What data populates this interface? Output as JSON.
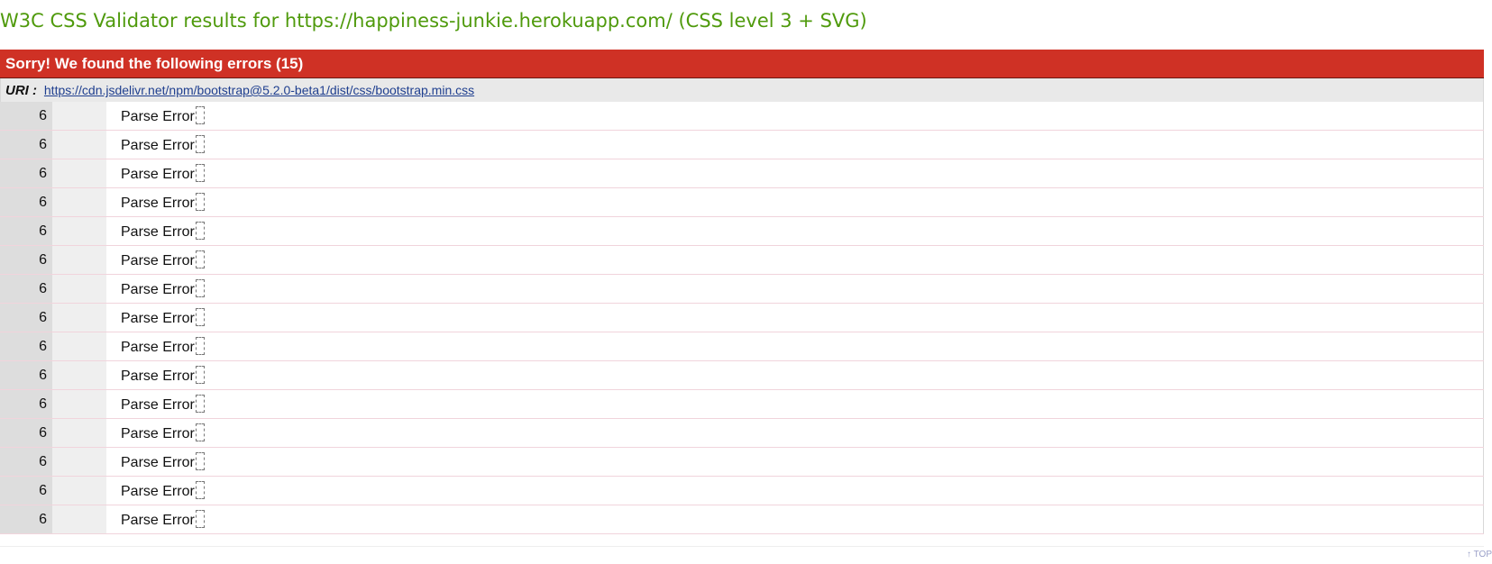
{
  "page": {
    "title": "W3C CSS Validator results for https://happiness-junkie.herokuapp.com/ (CSS level 3 + SVG)"
  },
  "errors": {
    "banner": "Sorry! We found the following errors (15)",
    "uri_label": "URI :",
    "uri": "https://cdn.jsdelivr.net/npm/bootstrap@5.2.0-beta1/dist/css/bootstrap.min.css",
    "rows": [
      {
        "line": "6",
        "context": "",
        "message": "Parse Error"
      },
      {
        "line": "6",
        "context": "",
        "message": "Parse Error"
      },
      {
        "line": "6",
        "context": "",
        "message": "Parse Error"
      },
      {
        "line": "6",
        "context": "",
        "message": "Parse Error"
      },
      {
        "line": "6",
        "context": "",
        "message": "Parse Error"
      },
      {
        "line": "6",
        "context": "",
        "message": "Parse Error"
      },
      {
        "line": "6",
        "context": "",
        "message": "Parse Error"
      },
      {
        "line": "6",
        "context": "",
        "message": "Parse Error"
      },
      {
        "line": "6",
        "context": "",
        "message": "Parse Error"
      },
      {
        "line": "6",
        "context": "",
        "message": "Parse Error"
      },
      {
        "line": "6",
        "context": "",
        "message": "Parse Error"
      },
      {
        "line": "6",
        "context": "",
        "message": "Parse Error"
      },
      {
        "line": "6",
        "context": "",
        "message": "Parse Error"
      },
      {
        "line": "6",
        "context": "",
        "message": "Parse Error"
      },
      {
        "line": "6",
        "context": "",
        "message": "Parse Error"
      }
    ]
  },
  "footer": {
    "top_link": "↑ TOP"
  },
  "colors": {
    "title": "#4f9a0c",
    "banner_bg": "#cf3125",
    "link": "#1f3f8f"
  },
  "icons": {
    "unprintable_char": "dashed-box-glyph-icon"
  }
}
